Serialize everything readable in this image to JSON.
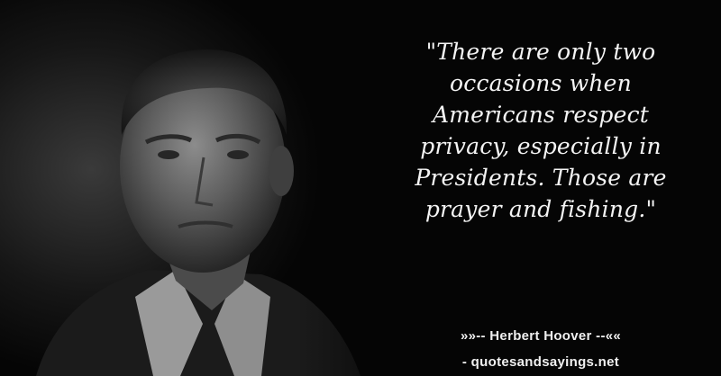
{
  "quote": {
    "lines": [
      "\"There are only two",
      "occasions when",
      "Americans respect",
      "privacy, especially in",
      "Presidents. Those are",
      "prayer and fishing.\""
    ]
  },
  "author": "»»-- Herbert Hoover --««",
  "source": "- quotesandsayings.net",
  "colors": {
    "background": "#050505",
    "text": "#f4f4f4"
  }
}
